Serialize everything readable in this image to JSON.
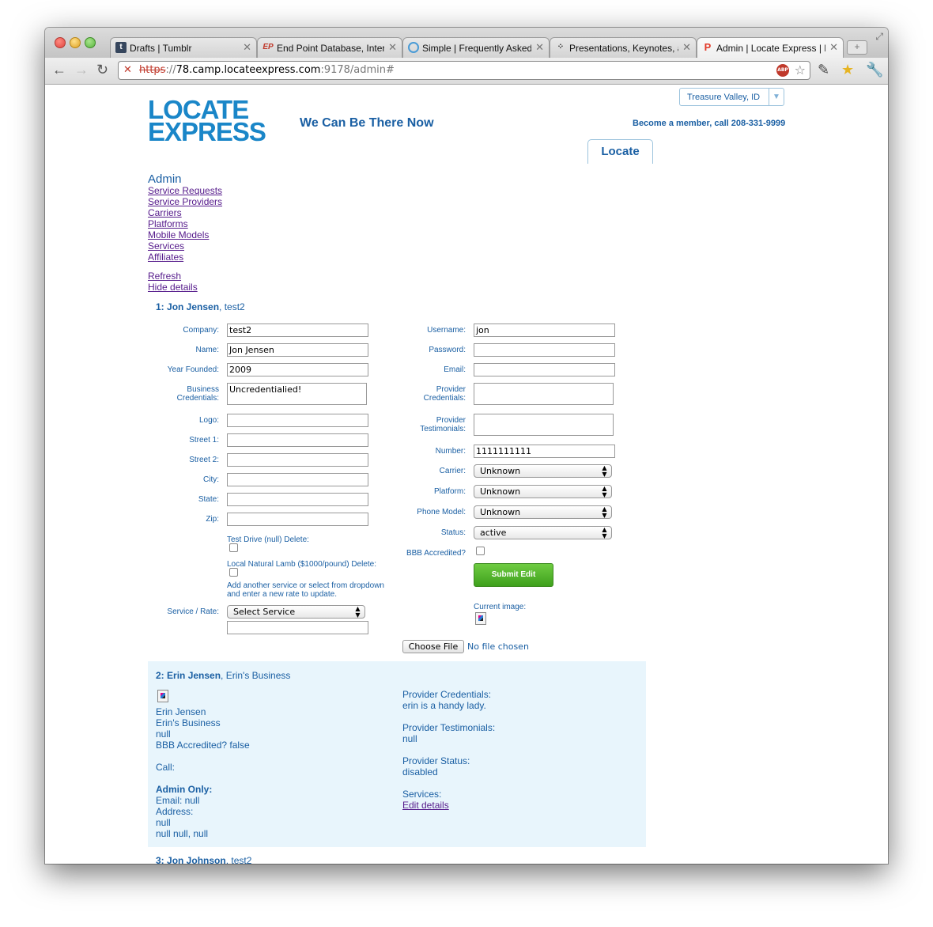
{
  "browser": {
    "tabs": [
      {
        "title": "Drafts | Tumblr",
        "favicon": "tumblr-icon"
      },
      {
        "title": "End Point Database, Interc",
        "favicon": "endpoint-icon"
      },
      {
        "title": "Simple | Frequently Asked",
        "favicon": "simple-icon"
      },
      {
        "title": "Presentations, Keynotes, a",
        "favicon": "presentations-icon"
      },
      {
        "title": "Admin | Locate Express | L",
        "favicon": "locate-pin-icon",
        "active": true
      }
    ],
    "url": {
      "scheme": "https",
      "sep": "://",
      "host": "78.camp.locateexpress.com",
      "rest": ":9178/admin#"
    }
  },
  "header": {
    "logo_line1": "LOCATE",
    "logo_line2": "EXPRESS",
    "tagline": "We Can Be There Now",
    "region": "Treasure Valley, ID",
    "member_text": "Become a member, call 208-331-9999",
    "locate_tab": "Locate"
  },
  "admin": {
    "heading": "Admin",
    "links": [
      "Service Requests",
      "Service Providers",
      "Carriers",
      "Platforms",
      "Mobile Models",
      "Services",
      "Affiliates"
    ],
    "refresh": "Refresh",
    "hide_details": "Hide details"
  },
  "record1": {
    "num": "1:",
    "name": "Jon Jensen",
    "company_suffix": ", test2",
    "labels": {
      "company": "Company:",
      "name": "Name:",
      "year": "Year Founded:",
      "bc1": "Business",
      "bc2": "Credentials:",
      "logo": "Logo:",
      "street1": "Street 1:",
      "street2": "Street 2:",
      "city": "City:",
      "state": "State:",
      "zip": "Zip:",
      "username": "Username:",
      "password": "Password:",
      "email": "Email:",
      "pc1": "Provider",
      "pc2": "Credentials:",
      "pt1": "Provider",
      "pt2": "Testimonials:",
      "number": "Number:",
      "carrier": "Carrier:",
      "platform": "Platform:",
      "phone_model": "Phone Model:",
      "status": "Status:",
      "bbb": "BBB Accredited?",
      "service_rate": "Service / Rate:",
      "current_image": "Current image:"
    },
    "values": {
      "company": "test2",
      "name": "Jon Jensen",
      "year": "2009",
      "business_credentials": "Uncredentialied!",
      "username": "jon",
      "number": "1111111111",
      "carrier": "Unknown",
      "platform": "Unknown",
      "phone_model": "Unknown",
      "status": "active",
      "service_select": "Select Service"
    },
    "services": [
      {
        "label": "Test Drive (null) Delete:"
      },
      {
        "label": "Local Natural Lamb ($1000/pound) Delete:"
      }
    ],
    "add_service_note1": "Add another service or select from dropdown",
    "add_service_note2": "and enter a new rate to update.",
    "submit": "Submit Edit",
    "choose_file": "Choose File",
    "no_file": "No file chosen"
  },
  "record2": {
    "num": "2:",
    "name": "Erin Jensen",
    "company_suffix": ", Erin's Business",
    "left_lines": [
      "Erin Jensen",
      "Erin's Business",
      "null",
      "BBB Accredited? false"
    ],
    "call": "Call:",
    "admin_only": "Admin Only:",
    "email": "Email: null",
    "address": "Address:",
    "addr1": "null",
    "addr2": "null null, null",
    "pc_label": "Provider Credentials:",
    "pc_value": "erin is a handy lady.",
    "pt_label": "Provider Testimonials:",
    "pt_value": "null",
    "ps_label": "Provider Status:",
    "ps_value": "disabled",
    "services_label": "Services:",
    "edit_details": "Edit details"
  },
  "record3": {
    "num": "3:",
    "name": "Jon Johnson",
    "company_suffix": ", test2"
  }
}
